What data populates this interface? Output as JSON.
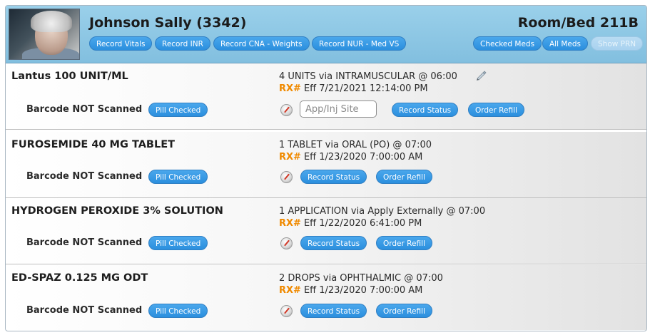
{
  "patient": {
    "name": "Johnson Sally (3342)",
    "room_bed": "Room/Bed 211B"
  },
  "header_buttons": {
    "record_vitals": "Record Vitals",
    "record_inr": "Record INR",
    "record_cna_weights": "Record CNA - Weights",
    "record_nur_med_vs": "Record NUR - Med VS",
    "checked_meds": "Checked Meds",
    "all_meds": "All Meds",
    "show_prn": "Show PRN"
  },
  "labels": {
    "rx": "RX#",
    "barcode_status": "Barcode NOT Scanned",
    "pill_checked": "Pill Checked",
    "record_status": "Record Status",
    "order_refill": "Order Refill",
    "site_placeholder": "App/Inj Site"
  },
  "medications": [
    {
      "name": "Lantus 100 UNIT/ML",
      "dose": "4 UNITS via INTRAMUSCULAR @ 06:00",
      "effective": "Eff 7/21/2021 12:14:00 PM"
    },
    {
      "name": "FUROSEMIDE 40 MG TABLET",
      "dose": "1 TABLET via ORAL (PO) @ 07:00",
      "effective": "Eff 1/23/2020 7:00:00 AM"
    },
    {
      "name": "HYDROGEN PEROXIDE 3% SOLUTION",
      "dose": "1 APPLICATION via Apply Externally @ 07:00",
      "effective": "Eff 1/22/2020 6:41:00 PM"
    },
    {
      "name": "ED-SPAZ 0.125 MG ODT",
      "dose": "2 DROPS via OPHTHALMIC @ 07:00",
      "effective": "Eff 1/23/2020 7:00:00 AM"
    }
  ],
  "icons": {
    "compass": "compass-icon",
    "pen": "pen-icon"
  },
  "colors": {
    "header_bg": "#9ad0ea",
    "button_blue": "#3399e6",
    "rx_orange": "#f08a00"
  }
}
